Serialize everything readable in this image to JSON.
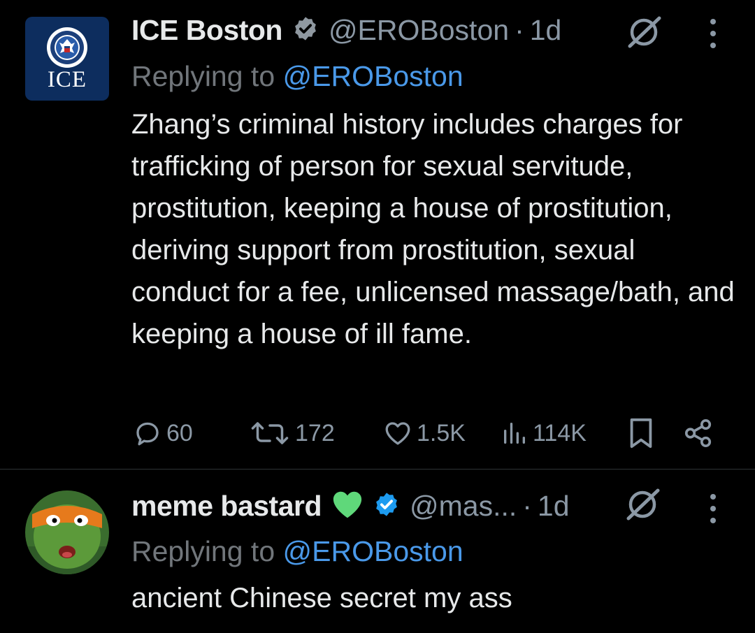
{
  "colors": {
    "background": "#000000",
    "text": "#e7e9ea",
    "secondary": "#71767b",
    "link": "#4a99e9",
    "verified": "#1d9bf0"
  },
  "tweets": [
    {
      "avatar": {
        "text": "ICE",
        "icon": "dhs-seal-icon"
      },
      "name": "ICE Boston",
      "verified_icon": "verified-badge-icon",
      "handle": "@EROBoston",
      "dot": "·",
      "time": "1d",
      "replying_prefix": "Replying to",
      "replying_to": "@EROBoston",
      "text": "Zhang’s criminal history includes charges for trafficking of person for sexual servitude, prostitution, keeping a house of prostitution, deriving support from prostitution, sexual conduct for a fee, unlicensed massage/bath, and keeping a house of ill fame.",
      "actions": {
        "replies": "60",
        "retweets": "172",
        "likes": "1.5K",
        "views": "114K"
      }
    },
    {
      "avatar": {
        "icon": "ninja-turtle-avatar"
      },
      "name": "meme bastard",
      "emoji": "green-heart-icon",
      "verified_icon": "verified-badge-icon",
      "handle": "@mas...",
      "dot": "·",
      "time": "1d",
      "replying_prefix": "Replying to",
      "replying_to": "@EROBoston",
      "text": "ancient Chinese secret my ass"
    }
  ]
}
